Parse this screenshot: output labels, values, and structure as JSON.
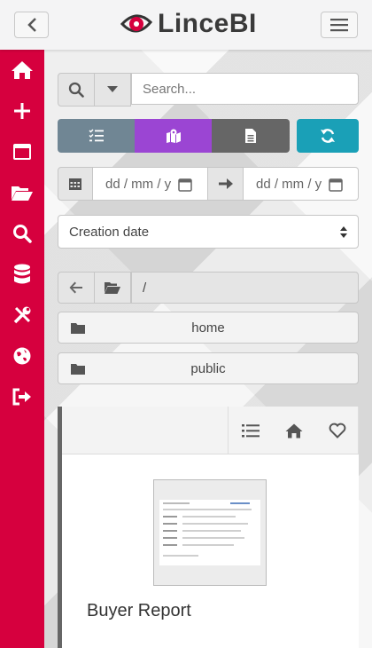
{
  "brand": {
    "name": "LinceBI"
  },
  "colors": {
    "sidebar": "#d6003e",
    "view_list": "#708694",
    "view_map": "#9b45d3",
    "view_doc": "#666666",
    "refresh": "#1aa0b7"
  },
  "sidebar": {
    "items": [
      {
        "icon": "home-icon"
      },
      {
        "icon": "plus-icon"
      },
      {
        "icon": "window-icon"
      },
      {
        "icon": "folder-open-icon"
      },
      {
        "icon": "search-icon"
      },
      {
        "icon": "database-icon"
      },
      {
        "icon": "tools-icon"
      },
      {
        "icon": "globe-icon"
      },
      {
        "icon": "sign-out-icon"
      }
    ]
  },
  "search": {
    "placeholder": "Search..."
  },
  "dates": {
    "from_placeholder": "dd / mm / y",
    "to_placeholder": "dd / mm / y"
  },
  "sort": {
    "selected": "Creation date"
  },
  "path": {
    "current": "/"
  },
  "folders": [
    {
      "label": "home"
    },
    {
      "label": "public"
    }
  ],
  "report": {
    "title": "Buyer Report"
  }
}
